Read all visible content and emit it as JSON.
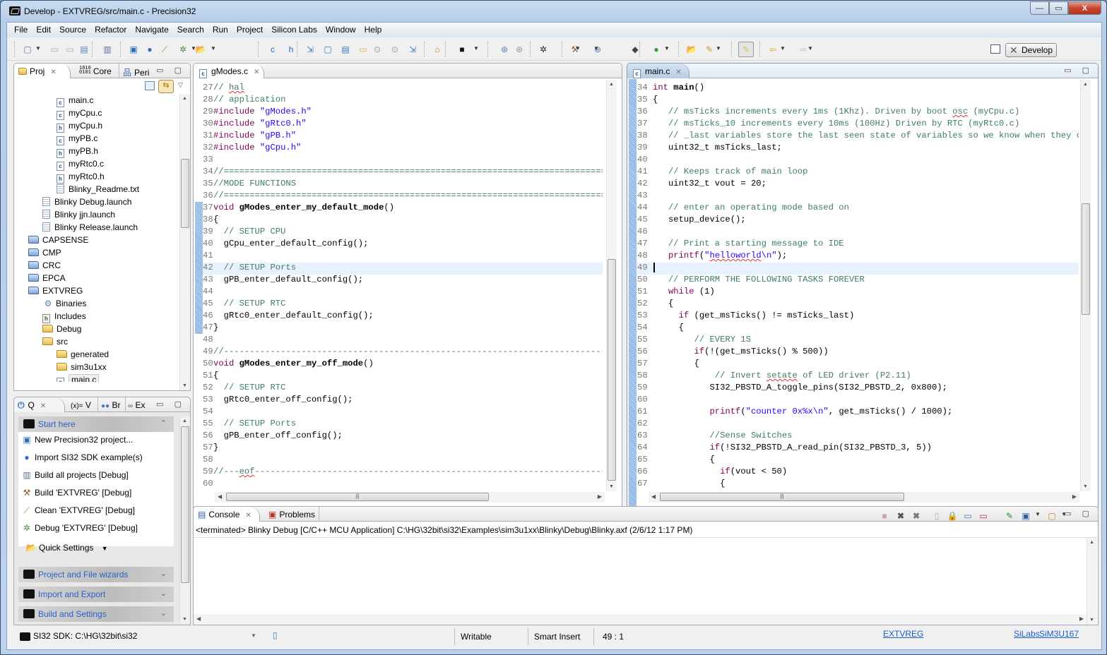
{
  "window": {
    "title": "Develop - EXTVREG/src/main.c - Precision32",
    "minimize_glyph": "—",
    "restore_glyph": "▭",
    "close_glyph": "X"
  },
  "menubar": [
    "File",
    "Edit",
    "Source",
    "Refactor",
    "Navigate",
    "Search",
    "Run",
    "Project",
    "Silicon Labs",
    "Window",
    "Help"
  ],
  "toolbar": {
    "perspective_label": "Develop",
    "icons": [
      "new-icon",
      "save-icon",
      "save-all-icon",
      "print-icon",
      "build-all-icon",
      "new-project-icon",
      "import-example-icon",
      "clean-icon",
      "debug-icon",
      "quick-settings-icon",
      "new-c-file-icon",
      "new-h-file-icon",
      "import-icon",
      "new-folder-icon",
      "export-xml-icon",
      "open-folder-icon",
      "link-icon",
      "upload-icon",
      "download-icon",
      "home-icon",
      "silabs-icon",
      "target-icon",
      "target-alt-icon",
      "debug-bug-icon",
      "build-hammer-icon",
      "settings-icon",
      "chip-icon",
      "run-icon",
      "open-type-icon",
      "pencil-icon",
      "highlight-icon",
      "back-icon",
      "forward-icon"
    ]
  },
  "project_panel": {
    "tabs": [
      {
        "label": "Proj",
        "close": "✕",
        "active": true
      },
      {
        "label": "Core",
        "active": false
      },
      {
        "label": "Peri",
        "active": false
      }
    ],
    "tree": [
      {
        "label": "main.c",
        "type": "c",
        "indent": 3
      },
      {
        "label": "myCpu.c",
        "type": "c",
        "indent": 3
      },
      {
        "label": "myCpu.h",
        "type": "h",
        "indent": 3
      },
      {
        "label": "myPB.c",
        "type": "c",
        "indent": 3
      },
      {
        "label": "myPB.h",
        "type": "h",
        "indent": 3
      },
      {
        "label": "myRtc0.c",
        "type": "c",
        "indent": 3
      },
      {
        "label": "myRtc0.h",
        "type": "h",
        "indent": 3
      },
      {
        "label": "Blinky_Readme.txt",
        "type": "doc",
        "indent": 3
      },
      {
        "label": "Blinky Debug.launch",
        "type": "doc",
        "indent": 2
      },
      {
        "label": "Blinky jjn.launch",
        "type": "doc",
        "indent": 2
      },
      {
        "label": "Blinky Release.launch",
        "type": "doc",
        "indent": 2
      },
      {
        "label": "CAPSENSE",
        "type": "project",
        "indent": 1
      },
      {
        "label": "CMP",
        "type": "project",
        "indent": 1
      },
      {
        "label": "CRC",
        "type": "project",
        "indent": 1
      },
      {
        "label": "EPCA",
        "type": "project",
        "indent": 1
      },
      {
        "label": "EXTVREG",
        "type": "project",
        "indent": 1
      },
      {
        "label": "Binaries",
        "type": "binaries",
        "indent": 2
      },
      {
        "label": "Includes",
        "type": "includes",
        "indent": 2
      },
      {
        "label": "Debug",
        "type": "folder",
        "indent": 2
      },
      {
        "label": "src",
        "type": "folder",
        "indent": 2
      },
      {
        "label": "generated",
        "type": "folder",
        "indent": 3
      },
      {
        "label": "sim3u1xx",
        "type": "folder",
        "indent": 3
      },
      {
        "label": "main.c",
        "type": "c",
        "indent": 3,
        "selected": true
      }
    ]
  },
  "quickaccess_panel": {
    "tabs": [
      {
        "label": "Q",
        "active": true
      },
      {
        "label": "V",
        "prefix": "(x)="
      },
      {
        "label": "Br"
      },
      {
        "label": "Ex"
      }
    ],
    "start_here": {
      "title": "Start here",
      "items": [
        {
          "label": "New Precision32 project...",
          "icon": "new-project-icon"
        },
        {
          "label": "Import SI32 SDK example(s)",
          "icon": "import-example-icon"
        },
        {
          "label": "Build all projects [Debug]",
          "icon": "build-all-icon"
        },
        {
          "label": "Build 'EXTVREG' [Debug]",
          "icon": "hammer-icon"
        },
        {
          "label": "Clean 'EXTVREG' [Debug]",
          "icon": "broom-icon"
        },
        {
          "label": "Debug 'EXTVREG' [Debug]",
          "icon": "bug-icon"
        }
      ],
      "quick_settings": "Quick Settings"
    },
    "sections": [
      "Project and File wizards",
      "Import and Export",
      "Build and Settings"
    ]
  },
  "editor_left": {
    "tab": "gModes.c",
    "lines": [
      {
        "n": 27,
        "html": "<span class='cm'>// <span class='sq'>hal</span></span>"
      },
      {
        "n": 28,
        "html": "<span class='cm'>// application</span>"
      },
      {
        "n": 29,
        "html": "<span class='pp'>#include</span> <span class='str'>\"gModes.h\"</span>"
      },
      {
        "n": 30,
        "html": "<span class='pp'>#include</span> <span class='str'>\"gRtc0.h\"</span>"
      },
      {
        "n": 31,
        "html": "<span class='pp'>#include</span> <span class='str'>\"gPB.h\"</span>"
      },
      {
        "n": 32,
        "html": "<span class='pp'>#include</span> <span class='str'>\"gCpu.h\"</span>"
      },
      {
        "n": 33,
        "html": ""
      },
      {
        "n": 34,
        "html": "<span class='cm'>//=================================================================================</span>"
      },
      {
        "n": 35,
        "html": "<span class='cm'>//MODE FUNCTIONS</span>"
      },
      {
        "n": 36,
        "html": "<span class='cm'>//=================================================================================</span>"
      },
      {
        "n": 37,
        "html": "<span class='kw'>void</span> <span class='fn'>gModes_enter_my_default_mode</span>()"
      },
      {
        "n": 38,
        "html": "{"
      },
      {
        "n": 39,
        "html": "  <span class='cm'>// SETUP CPU</span>"
      },
      {
        "n": 40,
        "html": "  gCpu_enter_default_config();"
      },
      {
        "n": 41,
        "html": ""
      },
      {
        "n": 42,
        "html": "  <span class='cm'>// SETUP Ports</span>",
        "hl": true
      },
      {
        "n": 43,
        "html": "  gPB_enter_default_config();"
      },
      {
        "n": 44,
        "html": ""
      },
      {
        "n": 45,
        "html": "  <span class='cm'>// SETUP RTC</span>"
      },
      {
        "n": 46,
        "html": "  gRtc0_enter_default_config();"
      },
      {
        "n": 47,
        "html": "}"
      },
      {
        "n": 48,
        "html": ""
      },
      {
        "n": 49,
        "html": "<span class='cm'>//---------------------------------------------------------------------------------</span>"
      },
      {
        "n": 50,
        "html": "<span class='kw'>void</span> <span class='fn'>gModes_enter_my_off_mode</span>()"
      },
      {
        "n": 51,
        "html": "{"
      },
      {
        "n": 52,
        "html": "  <span class='cm'>// SETUP RTC</span>"
      },
      {
        "n": 53,
        "html": "  gRtc0_enter_off_config();"
      },
      {
        "n": 54,
        "html": ""
      },
      {
        "n": 55,
        "html": "  <span class='cm'>// SETUP Ports</span>"
      },
      {
        "n": 56,
        "html": "  gPB_enter_off_config();"
      },
      {
        "n": 57,
        "html": "}"
      },
      {
        "n": 58,
        "html": ""
      },
      {
        "n": 59,
        "html": "<span class='cm'>//---<span class='sq'>eof</span>------------------------------------------------------------------------------</span>"
      },
      {
        "n": 60,
        "html": ""
      }
    ]
  },
  "editor_right": {
    "tab": "main.c",
    "lines": [
      {
        "n": 34,
        "html": "<span class='kw'>int</span> <span class='fn'>main</span>()"
      },
      {
        "n": 35,
        "html": "{"
      },
      {
        "n": 36,
        "html": "   <span class='cm'>// msTicks increments every 1ms (1Khz). Driven by boot <span class='sq'>osc</span> (myCpu.c)</span>"
      },
      {
        "n": 37,
        "html": "   <span class='cm'>// msTicks_10 increments every 10ms (100Hz) Driven by RTC (myRtc0.c)</span>"
      },
      {
        "n": 38,
        "html": "   <span class='cm'>// _last variables store the last seen state of variables so we know when they change</span>"
      },
      {
        "n": 39,
        "html": "   uint32_t msTicks_last;"
      },
      {
        "n": 40,
        "html": ""
      },
      {
        "n": 41,
        "html": "   <span class='cm'>// Keeps track of main loop</span>"
      },
      {
        "n": 42,
        "html": "   uint32_t vout = 20;"
      },
      {
        "n": 43,
        "html": ""
      },
      {
        "n": 44,
        "html": "   <span class='cm'>// enter an operating mode based on</span>"
      },
      {
        "n": 45,
        "html": "   setup_device();"
      },
      {
        "n": 46,
        "html": ""
      },
      {
        "n": 47,
        "html": "   <span class='cm'>// Print a starting message to IDE</span>"
      },
      {
        "n": 48,
        "html": "   <span class='kw'>printf</span>(<span class='str'>\"<span class='sq'>helloworld</span>\\n\"</span>);"
      },
      {
        "n": 49,
        "html": "",
        "hl": true,
        "cursor": true
      },
      {
        "n": 50,
        "html": "   <span class='cm'>// PERFORM THE FOLLOWING TASKS FOREVER</span>"
      },
      {
        "n": 51,
        "html": "   <span class='kw'>while</span> (1)"
      },
      {
        "n": 52,
        "html": "   {"
      },
      {
        "n": 53,
        "html": "     <span class='kw'>if</span> (get_msTicks() != msTicks_last)"
      },
      {
        "n": 54,
        "html": "     {"
      },
      {
        "n": 55,
        "html": "        <span class='cm'>// EVERY 1S</span>"
      },
      {
        "n": 56,
        "html": "        <span class='kw'>if</span>(!(get_msTicks() % 500))"
      },
      {
        "n": 57,
        "html": "        {"
      },
      {
        "n": 58,
        "html": "            <span class='cm'>// Invert <span class='sq'>setate</span> of LED driver (P2.11)</span>"
      },
      {
        "n": 59,
        "html": "           SI32_PBSTD_A_toggle_pins(SI32_PBSTD_2, 0x800);"
      },
      {
        "n": 60,
        "html": ""
      },
      {
        "n": 61,
        "html": "           <span class='kw'>printf</span>(<span class='str'>\"counter 0x%x\\n\"</span>, get_msTicks() / 1000);"
      },
      {
        "n": 62,
        "html": ""
      },
      {
        "n": 63,
        "html": "           <span class='cm'>//Sense Switches</span>"
      },
      {
        "n": 64,
        "html": "           <span class='kw'>if</span>(!SI32_PBSTD_A_read_pin(SI32_PBSTD_3, 5))"
      },
      {
        "n": 65,
        "html": "           {"
      },
      {
        "n": 66,
        "html": "             <span class='kw'>if</span>(vout &lt; 50)"
      },
      {
        "n": 67,
        "html": "             {"
      }
    ]
  },
  "console": {
    "tabs": [
      {
        "label": "Console",
        "active": true
      },
      {
        "label": "Problems"
      }
    ],
    "status_line": "<terminated> Blinky Debug [C/C++ MCU Application] C:\\HG\\32bit\\si32\\Examples\\sim3u1xx\\Blinky\\Debug\\Blinky.axf (2/6/12 1:17 PM)",
    "output": ""
  },
  "statusbar": {
    "sdk": "SI32 SDK:  C:\\HG\\32bit\\si32",
    "writable": "Writable",
    "insert_mode": "Smart Insert",
    "position": "49 : 1",
    "project_link": "EXTVREG",
    "vendor_link": "SiLabs",
    "device_link": "SiM3U167"
  }
}
